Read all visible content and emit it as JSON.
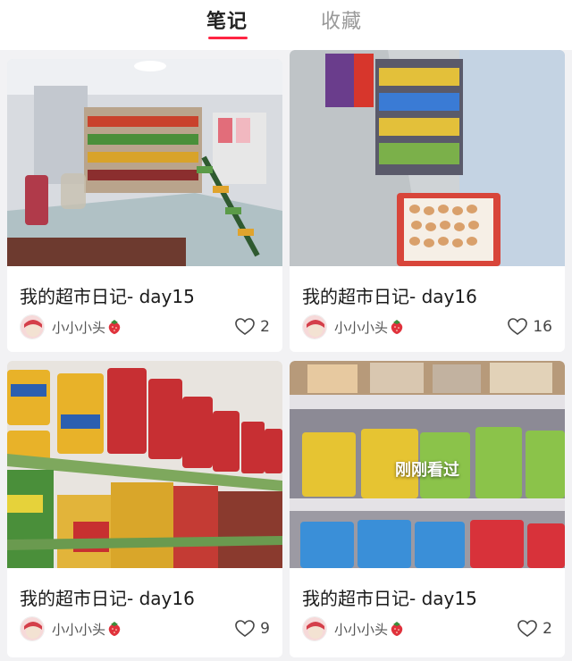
{
  "tabs": [
    {
      "label": "笔记",
      "active": true
    },
    {
      "label": "收藏",
      "active": false
    }
  ],
  "accent_color": "#ff2442",
  "cards": [
    {
      "title": "我的超市日记- day15",
      "author": "小小小头",
      "likes": "2",
      "image": "convenience-store-shelves",
      "viewed_label": ""
    },
    {
      "title": "我的超市日记- day16",
      "author": "小小小头",
      "likes": "16",
      "image": "store-aisle-with-eggs",
      "viewed_label": ""
    },
    {
      "title": "我的超市日记- day16",
      "author": "小小小头",
      "likes": "9",
      "image": "instant-noodle-shelves",
      "viewed_label": ""
    },
    {
      "title": "我的超市日记- day15",
      "author": "小小小头",
      "likes": "2",
      "image": "snack-bag-shelves",
      "viewed_label": "刚刚看过"
    }
  ]
}
